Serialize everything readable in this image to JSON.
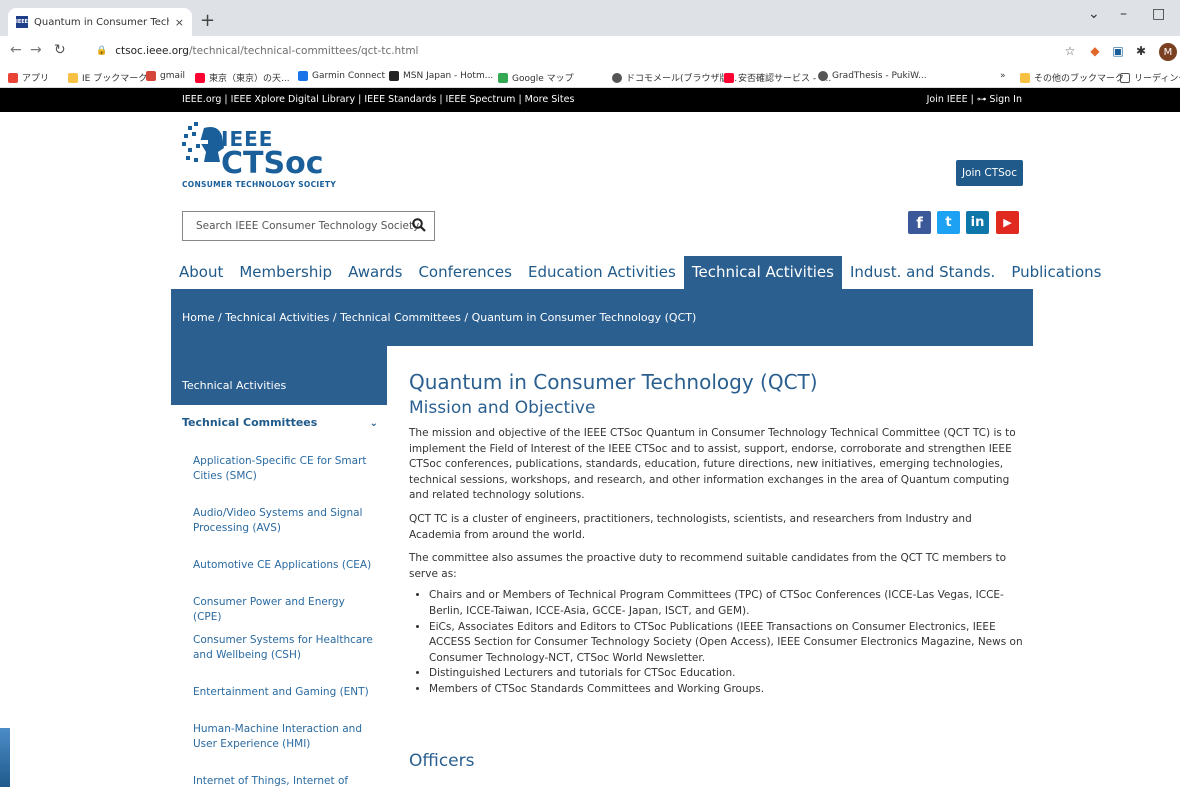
{
  "browser": {
    "tab_title": "Quantum in Consumer Technolo",
    "tab_favicon": "IEEE",
    "new_tab": "+",
    "close_tab": "×",
    "url_host": "ctsoc.ieee.org",
    "url_path": "/technical/technical-committees/qct-tc.html",
    "profile_initial": "M",
    "bookmarks": [
      "アプリ",
      "IE ブックマーク",
      "gmail",
      "東京（東京）の天...",
      "Garmin Connect",
      "MSN Japan - Hotm...",
      "Google マップ",
      "ドコモメール(ブラウザ版...",
      "安否確認サービス - Y...",
      "GradThesis - PukiW..."
    ],
    "bookmarks_more": "»",
    "other_bookmarks": "その他のブックマーク",
    "reading_list": "リーディング リ"
  },
  "ieee_bar": {
    "links": "IEEE.org  |  IEEE Xplore Digital Library  |  IEEE Standards  |  IEEE Spectrum  |  More Sites",
    "right": "Join IEEE  |  ⊶ Sign In"
  },
  "header": {
    "logo_ieee": "IEEE",
    "logo_ctsoc": "CTSoc",
    "logo_sub": "CONSUMER TECHNOLOGY SOCIETY",
    "join_label": "Join CTSoc",
    "search_placeholder": "Search IEEE Consumer Technology Society"
  },
  "nav": [
    "About",
    "Membership",
    "Awards",
    "Conferences",
    "Education Activities",
    "Technical Activities",
    "Indust. and Stands.",
    "Publications"
  ],
  "breadcrumb": "Home /  Technical Activities /  Technical Committees /  Quantum in Consumer Technology (QCT)",
  "sidebar": {
    "head": "Technical Activities",
    "section": "Technical Committees",
    "items": [
      "Application-Specific CE for Smart Cities (SMC)",
      "Audio/Video Systems and Signal Processing (AVS)",
      "Automotive CE Applications (CEA)",
      "Consumer Power and Energy (CPE)",
      "Consumer Systems for Healthcare and Wellbeing (CSH)",
      "Entertainment and Gaming (ENT)",
      "Human-Machine Interaction and User Experience (HMI)",
      "Internet of Things, Internet of"
    ]
  },
  "content": {
    "title": "Quantum in Consumer Technology (QCT)",
    "mission_heading": "Mission and Objective",
    "p1": "The mission and objective of the IEEE CTSoc Quantum in Consumer Technology Technical Committee (QCT TC) is to implement the Field of Interest of the IEEE CTSoc and to assist, support, endorse, corroborate and strengthen IEEE CTSoc conferences, publications, standards, education, future directions, new initiatives, emerging technologies, technical sessions, workshops, and research, and other information exchanges in the area of Quantum computing and related technology solutions.",
    "p2": "QCT TC is a cluster of engineers, practitioners, technologists, scientists, and researchers from Industry and Academia from around the world.",
    "p3": "The committee also assumes the proactive duty to recommend suitable candidates from the QCT TC members to serve as:",
    "bullets": [
      "Chairs and or Members of Technical Program Committees (TPC) of CTSoc Conferences (ICCE-Las Vegas, ICCE-Berlin, ICCE-Taiwan, ICCE-Asia, GCCE- Japan, ISCT, and GEM).",
      "EiCs, Associates Editors and Editors to CTSoc Publications (IEEE Transactions on Consumer Electronics, IEEE ACCESS Section for Consumer Technology Society (Open Access), IEEE Consumer Electronics Magazine, News on Consumer Technology-NCT, CTSoc World Newsletter.",
      "Distinguished Lecturers and tutorials for CTSoc Education.",
      "Members of CTSoc Standards Committees and Working Groups."
    ],
    "officers_heading": "Officers"
  }
}
